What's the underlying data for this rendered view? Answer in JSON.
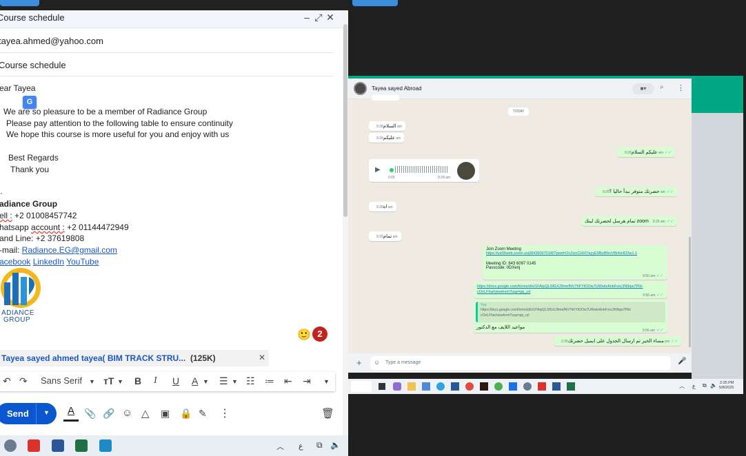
{
  "gmail": {
    "window_title": "Course schedule",
    "to": "tayea.ahmed@yahoo.com",
    "subject": "Course schedule",
    "body": {
      "greeting": "ear  Tayea",
      "line1": " We are so pleasure to be a member of Radiance Group",
      "line2": "Please pay attention to the following table to ensure continuity",
      "line3": "We hope this course is more useful for you and enjoy with us",
      "regards": "Best Regards",
      "thanks": "Thank you",
      "company": "adiance Group",
      "cell_label": "ell :",
      "cell_value": " +2 01008457742",
      "whatsapp_label1": "hatsapp ",
      "whatsapp_label2": "account :",
      "whatsapp_value": " +2 01144472949",
      "landline": "and Line: +2 37619808",
      "email_label": "-mail: ",
      "email_value": "Radiance.EG@gmail.com",
      "social": [
        "acebook",
        "LinkedIn",
        "YouTube "
      ],
      "logo_text": [
        "ADIANCE",
        "GROUP"
      ]
    },
    "notification_count": "2",
    "attachment": {
      "name": "Tayea sayed ahmed tayea( BIM TRACK STRU...",
      "size": "(125K)"
    },
    "toolbar": {
      "font": "Sans Serif"
    },
    "send_label": "Send"
  },
  "taskbar_left": {
    "lang": "ع"
  },
  "whatsapp": {
    "contact": "Tayea sayed Abroad",
    "day_label": "TODAY",
    "messages": [
      {
        "dir": "in",
        "text": "السلام",
        "time": "9:28 am"
      },
      {
        "dir": "in",
        "text": "عليكم",
        "time": "9:28 am"
      },
      {
        "dir": "out",
        "text": "عليكم السلام",
        "time": "9:28 am"
      },
      {
        "dir": "in",
        "type": "voice",
        "duration": "0:05",
        "time": "9:28 am"
      },
      {
        "dir": "out",
        "text": "حضرتك متوفر نبدأ حاليا ؟",
        "time": "9:28 am"
      },
      {
        "dir": "in",
        "text": "اه",
        "time": "9:28 am"
      },
      {
        "dir": "out",
        "text": "تمام هرسل لحضرتك لينك zoom",
        "time": "9:29 am"
      },
      {
        "dir": "in",
        "text": "تمام",
        "time": "9:29 am"
      },
      {
        "dir": "out",
        "title": "Join Zoom Meeting",
        "link": "https://us05web.zoom.us/j/84360970145?pwd=OcZwcCHXI7azyE9BuB5mVBi4vHO2w1.1",
        "id": "Meeting ID: 843 6097 0145",
        "pass": "Passcode: 0DXenj",
        "time": "9:50 am"
      },
      {
        "dir": "out",
        "link": "https://docs.google.com/forms/d/e/1FAIpQLSfGXJ9mefNV7hFYtOOw7UWwlzAnbFvxc3N9qw7PId-cOnLFhw/viewform?usp=pp_url",
        "time": "9:56 am"
      },
      {
        "dir": "out",
        "quote_author": "You",
        "quote": "https://docs.google.com/forms/d/e/1FAIpQLSfGXJ9mefNV7hFYtOOw7UWwlzAnbFvxc3N9qw7PId-cOnLFhw/viewform?usp=pp_url",
        "text": "مواعيد اللايف مع الدكتور",
        "time": "9:56 am"
      },
      {
        "dir": "out",
        "text": "مساء الخير تم ارسال الجدول على ايميل حضرتك",
        "time": "2:35 pm"
      }
    ],
    "input_placeholder": "Type a message"
  },
  "taskbar_right": {
    "lang": "ع",
    "time": "2:35 PM",
    "date": "5/8/2025"
  }
}
